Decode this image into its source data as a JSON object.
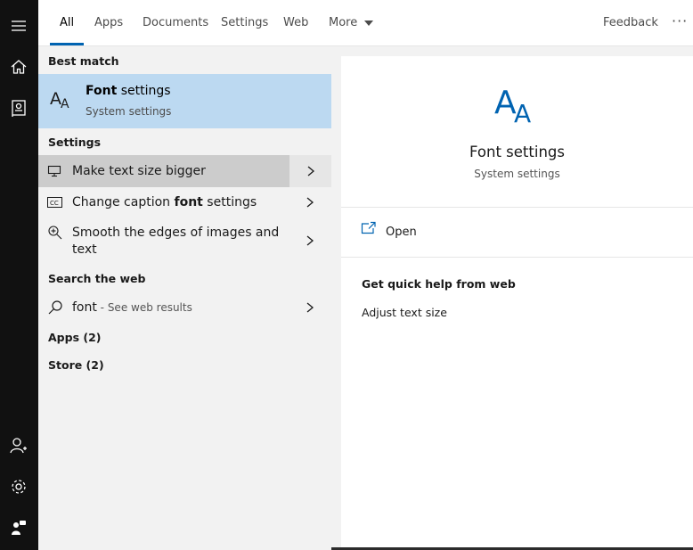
{
  "tabs": {
    "items": [
      "All",
      "Apps",
      "Documents",
      "Settings",
      "Web",
      "More"
    ],
    "active": "All",
    "feedback": "Feedback",
    "more_icon": "ellipsis-icon"
  },
  "rail": {
    "icons": [
      "hamburger-icon",
      "home-icon",
      "notebook-icon",
      "person-add-icon",
      "gear-icon",
      "feedback-hub-icon"
    ]
  },
  "results": {
    "best_match_header": "Best match",
    "best_match": {
      "title_bold": "Font",
      "title_rest": " settings",
      "subtitle": "System settings",
      "icon": "font-icon"
    },
    "settings_header": "Settings",
    "settings_items": [
      {
        "pre": "Make text size bigger",
        "bold": "",
        "post": "",
        "icon": "monitor-icon"
      },
      {
        "pre": "Change caption ",
        "bold": "font",
        "post": " settings",
        "icon": "cc-icon"
      },
      {
        "pre": "Smooth the edges of images and",
        "bold": "",
        "post": "text",
        "icon": "magnifier-plus-icon"
      }
    ],
    "web_header": "Search the web",
    "web_item": {
      "query": "font",
      "suffix": " - See web results",
      "icon": "search-icon"
    },
    "apps_header": "Apps (2)",
    "store_header": "Store (2)"
  },
  "preview": {
    "title": "Font settings",
    "subtitle": "System settings",
    "open_label": "Open",
    "quick_help_header": "Get quick help from web",
    "quick_help_item": "Adjust text size"
  },
  "colors": {
    "accent": "#0063b1",
    "best_match_bg": "#bcd9f1",
    "hover_bg": "#cccccc",
    "rail_bg": "#111111"
  }
}
